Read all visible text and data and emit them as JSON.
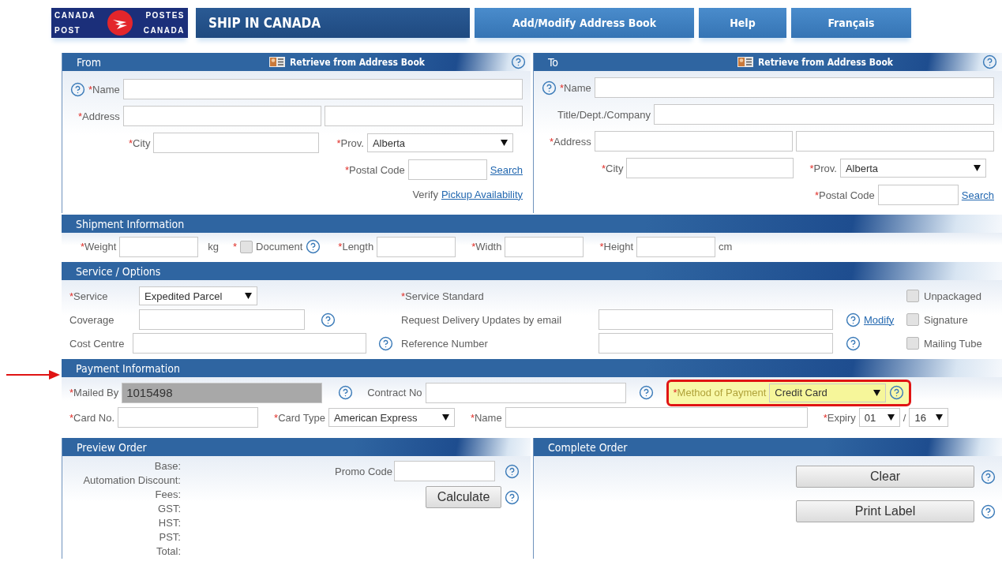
{
  "logo": {
    "line_1_left": "CANADA",
    "line_1_right": "POSTES",
    "line_2_left": "POST",
    "line_2_right": "CANADA"
  },
  "tabs": [
    {
      "label": "SHIP IN CANADA",
      "selected": true
    },
    {
      "label": "Add/Modify Address Book",
      "selected": false
    },
    {
      "label": "Help",
      "selected": false
    },
    {
      "label": "Français",
      "selected": false
    }
  ],
  "from_panel": {
    "title": "From",
    "retrieve_link": "Retrieve from Address Book",
    "name": {
      "mark": "*",
      "label": "Name"
    },
    "address": {
      "mark": "*",
      "label": "Address"
    },
    "city": {
      "mark": "*",
      "label": "City"
    },
    "province": {
      "mark": "*",
      "label": "Prov.",
      "value": "Alberta"
    },
    "postal_code": {
      "mark": "*",
      "label": "Postal Code",
      "link": "Search"
    },
    "verify": {
      "text": "Verify",
      "link": "Pickup Availability"
    }
  },
  "to_panel": {
    "title": "To",
    "retrieve_link": "Retrieve from Address Book",
    "name": {
      "mark": "*",
      "label": "Name"
    },
    "company": {
      "label": "Title/Dept./Company"
    },
    "address": {
      "mark": "*",
      "label": "Address"
    },
    "city": {
      "mark": "*",
      "label": "City"
    },
    "province": {
      "mark": "*",
      "label": "Prov.",
      "value": "Alberta"
    },
    "postal_code": {
      "mark": "*",
      "label": "Postal Code",
      "link": "Search"
    }
  },
  "shipment": {
    "title": "Shipment Information",
    "weight": {
      "mark": "*",
      "label": "Weight",
      "unit": "kg"
    },
    "document": {
      "mark": "*",
      "label": "Document",
      "checked": false
    },
    "length": {
      "mark": "*",
      "label": "Length"
    },
    "width": {
      "mark": "*",
      "label": "Width"
    },
    "height": {
      "mark": "*",
      "label": "Height",
      "unit": "cm"
    }
  },
  "service": {
    "title": "Service / Options",
    "service": {
      "mark": "*",
      "label": "Service",
      "value": "Expedited Parcel"
    },
    "coverage": {
      "label": "Coverage"
    },
    "cost_centre": {
      "label": "Cost Centre"
    },
    "service_standard": {
      "mark": "*",
      "label": "Service Standard"
    },
    "email_updates": {
      "label": "Request Delivery Updates by email",
      "link": "Modify"
    },
    "reference": {
      "label": "Reference Number"
    },
    "options": [
      {
        "label": "Unpackaged",
        "checked": false
      },
      {
        "label": "Signature",
        "checked": false
      },
      {
        "label": "Mailing Tube",
        "checked": false
      }
    ]
  },
  "payment": {
    "title": "Payment Information",
    "mailed_by": {
      "mark": "*",
      "label": "Mailed By",
      "value": "1015498",
      "disabled": true
    },
    "contract_no": {
      "label": "Contract No"
    },
    "method": {
      "mark": "*",
      "label": "Method of Payment",
      "value": "Credit Card",
      "highlighted": true
    },
    "card_no": {
      "mark": "*",
      "label": "Card No."
    },
    "card_type": {
      "mark": "*",
      "label": "Card Type",
      "value": "American Express"
    },
    "name": {
      "mark": "*",
      "label": "Name"
    },
    "expiry": {
      "mark": "*",
      "label": "Expiry",
      "month": "01",
      "separator": "/",
      "year": "16"
    }
  },
  "preview": {
    "title": "Preview Order",
    "lines": [
      "Base:",
      "Automation Discount:",
      "Fees:",
      "GST:",
      "HST:",
      "PST:",
      "Total:"
    ],
    "promo": {
      "label": "Promo Code"
    },
    "calculate": "Calculate"
  },
  "complete": {
    "title": "Complete Order",
    "buttons": [
      "Clear",
      "Print Label"
    ]
  }
}
